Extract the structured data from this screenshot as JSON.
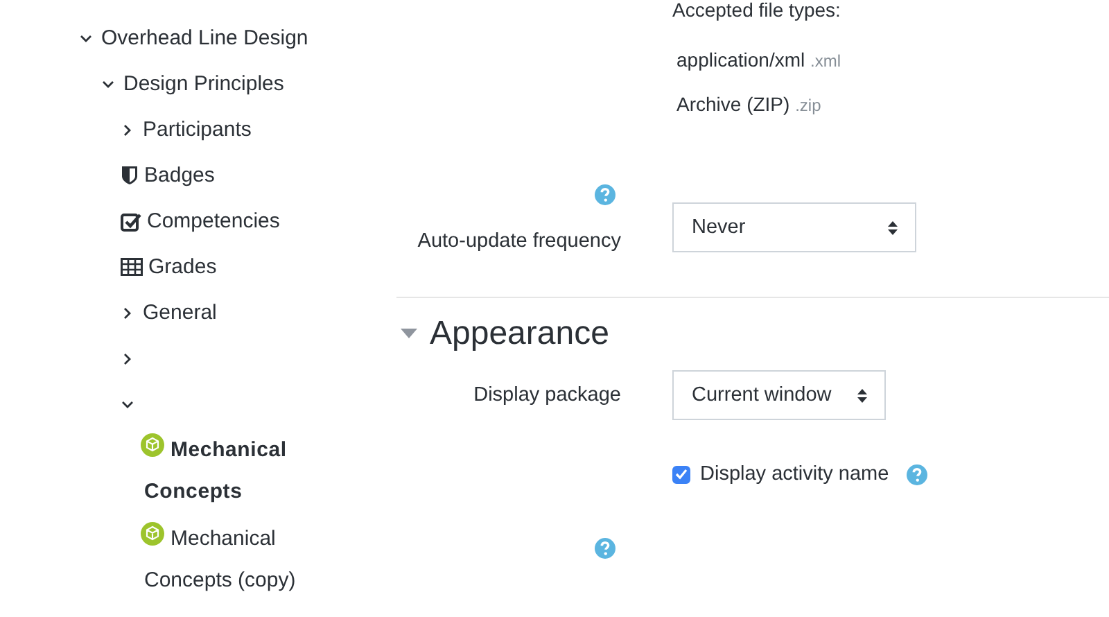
{
  "course_tree": [
    {
      "kind": "expandable",
      "label": "Overhead Line Design",
      "expanded": true,
      "children": [
        {
          "kind": "expandable",
          "label": "Design Principles",
          "expanded": true,
          "children": [
            {
              "kind": "expandable",
              "label": "Participants",
              "expanded": false
            },
            {
              "kind": "badges",
              "label": "Badges"
            },
            {
              "kind": "competencies",
              "label": "Competencies"
            },
            {
              "kind": "grades",
              "label": "Grades"
            },
            {
              "kind": "expandable",
              "label": "General",
              "expanded": false
            },
            {
              "kind": "expandable",
              "expanded": false
            },
            {
              "kind": "expandable",
              "expanded": true,
              "children": [
                {
                  "kind": "activity",
                  "label": "Mechanical Concepts",
                  "selected": true
                },
                {
                  "kind": "activity",
                  "label": "Mechanical Concepts (copy)",
                  "selected": false
                }
              ]
            }
          ]
        }
      ]
    }
  ],
  "file_types": {
    "heading": "Accepted file types:",
    "types": [
      {
        "name": "application/xml",
        "extension": ".xml"
      },
      {
        "name": "Archive (ZIP)",
        "extension": ".zip"
      }
    ]
  },
  "auto_update": {
    "label": "Auto-update frequency",
    "value": "Never"
  },
  "appearance": {
    "title": "Appearance",
    "expanded": true,
    "display_package": {
      "label": "Display package",
      "value": "Current window"
    },
    "display_activity_name": {
      "label": "Display activity name",
      "checked": true
    }
  }
}
